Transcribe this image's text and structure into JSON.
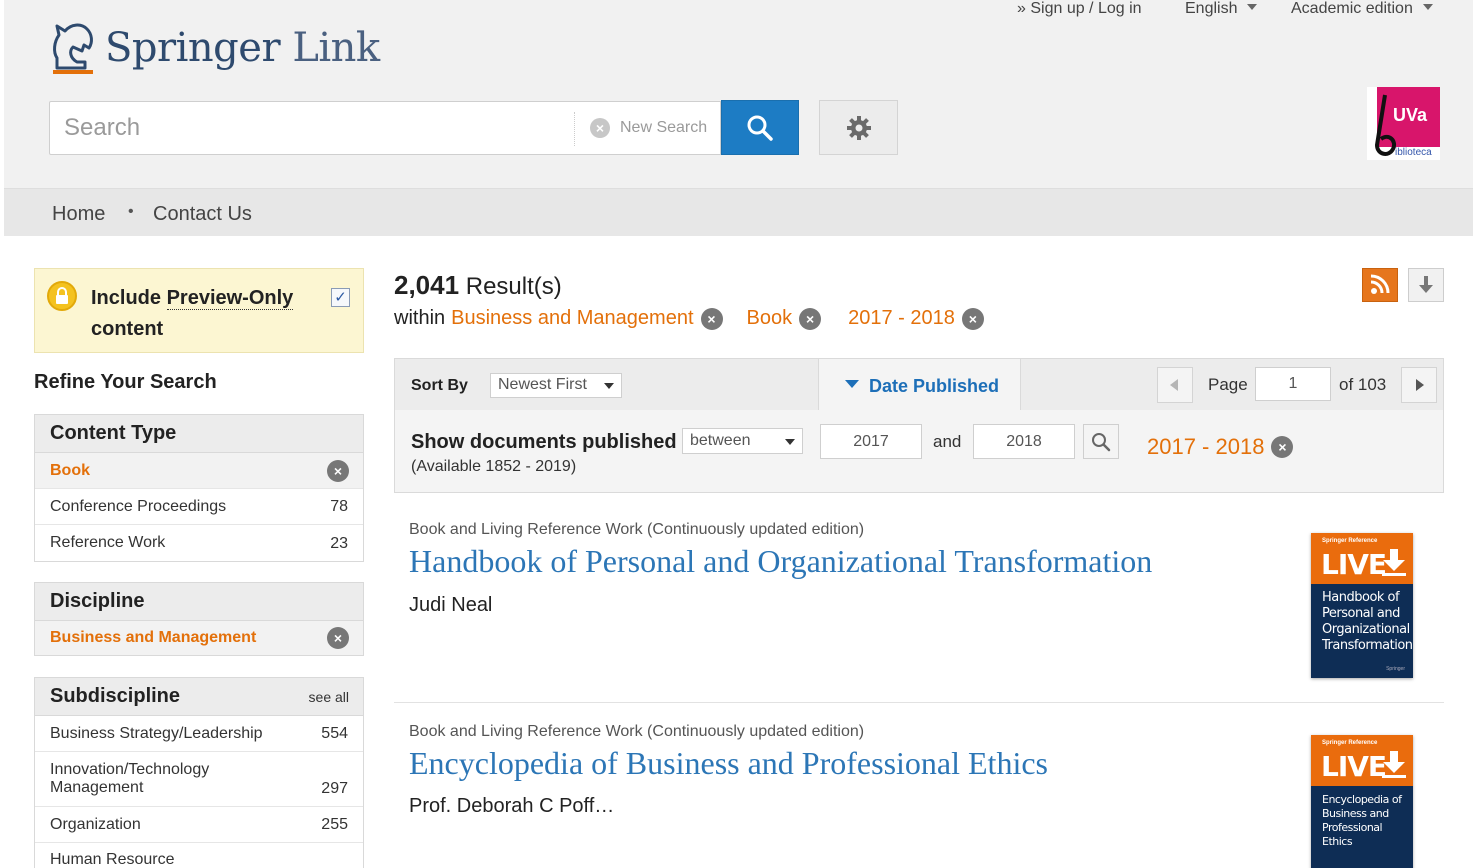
{
  "header": {
    "logo_word1": "Springer",
    "logo_word2": "Link",
    "signup": "» Sign up / Log in",
    "language": "English",
    "edition": "Academic edition",
    "search_placeholder": "Search",
    "new_search": "New Search",
    "institution_logo_text": "UVa",
    "institution_logo_sub": "iblioteca"
  },
  "nav": {
    "home": "Home",
    "separator": "•",
    "contact": "Contact Us"
  },
  "sidebar": {
    "preview_label_1": "Include ",
    "preview_label_2": "Preview-Only",
    "preview_label_3": "content",
    "preview_checked": "✓",
    "refine_title": "Refine Your Search",
    "content_type": {
      "title": "Content Type",
      "selected": "Book",
      "items": [
        {
          "label": "Conference Proceedings",
          "count": "78"
        },
        {
          "label": "Reference Work",
          "count": "23"
        }
      ]
    },
    "discipline": {
      "title": "Discipline",
      "selected": "Business and Management"
    },
    "subdiscipline": {
      "title": "Subdiscipline",
      "see_all": "see all",
      "items": [
        {
          "label": "Business Strategy/Leadership",
          "count": "554"
        },
        {
          "label": "Innovation/Technology Management",
          "count": "297"
        },
        {
          "label": "Organization",
          "count": "255"
        },
        {
          "label": "Human Resource",
          "count": ""
        }
      ]
    }
  },
  "results": {
    "count": "2,041",
    "count_label": " Result(s)",
    "within": "within",
    "filters": [
      "Business and Management",
      "Book",
      "2017 - 2018"
    ],
    "sort_label": "Sort By",
    "sort_value": "Newest First",
    "date_tab": "Date Published",
    "page_label": "Page",
    "page_value": "1",
    "page_of": "of 103",
    "show_docs": "Show documents published",
    "available": "(Available 1852 - 2019)",
    "range_mode": "between",
    "year_from": "2017",
    "year_and": "and",
    "year_to": "2018",
    "date_filter": "2017 - 2018",
    "items": [
      {
        "type": "Book and Living Reference Work (Continuously updated edition)",
        "title": "Handbook of Personal and Organizational Transformation",
        "author": "Judi Neal",
        "cover_series": "Springer Reference",
        "cover_live": "LIVE",
        "cover_title": "Handbook of Personal and Organizational Transformation",
        "cover_pub": "Springer"
      },
      {
        "type": "Book and Living Reference Work (Continuously updated edition)",
        "title": "Encyclopedia of Business and Professional Ethics",
        "author": "Prof. Deborah C Poff…",
        "cover_series": "Springer Reference",
        "cover_live": "LIVE",
        "cover_title": "Encyclopedia of Business and Professional Ethics",
        "cover_pub": ""
      }
    ]
  },
  "colors": {
    "accent_orange": "#e3700a",
    "link_blue": "#2c76b6",
    "search_blue": "#1d7cc4"
  }
}
